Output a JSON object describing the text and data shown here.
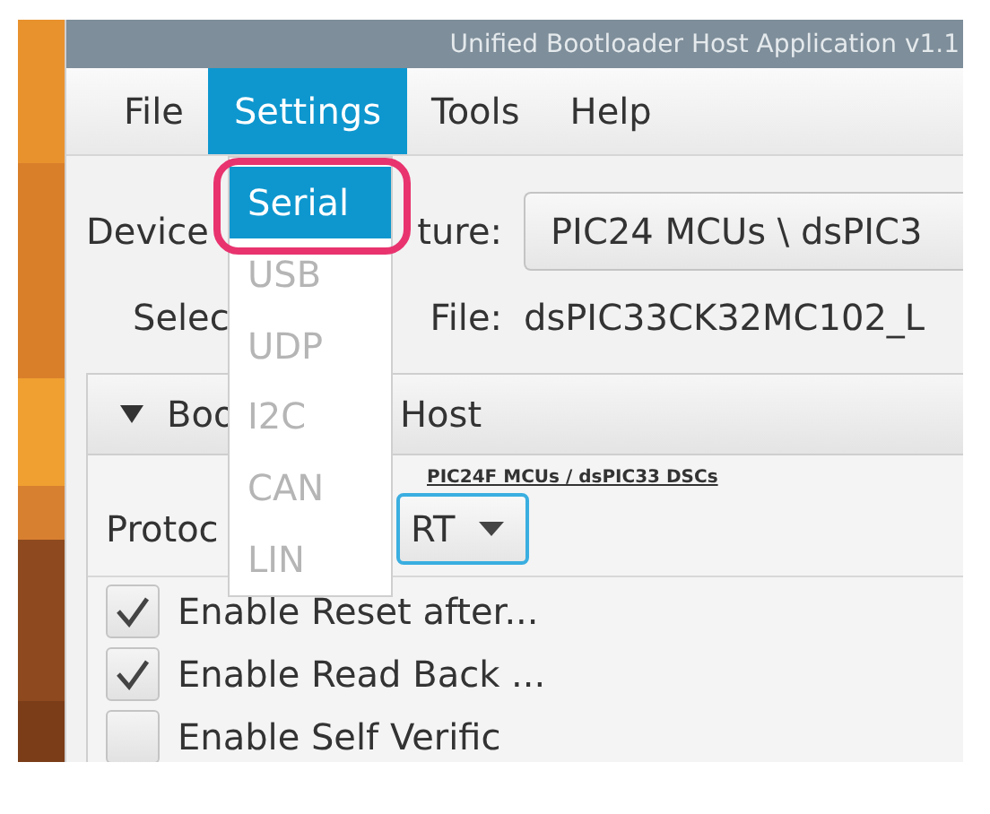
{
  "window": {
    "title": "Unified Bootloader Host Application v1.1"
  },
  "menu": [
    {
      "label": "File",
      "selected": false
    },
    {
      "label": "Settings",
      "selected": true
    },
    {
      "label": "Tools",
      "selected": false
    },
    {
      "label": "Help",
      "selected": false
    }
  ],
  "settings_menu": [
    {
      "label": "Serial",
      "selected": true,
      "disabled": false
    },
    {
      "label": "USB",
      "selected": false,
      "disabled": true
    },
    {
      "label": "UDP",
      "selected": false,
      "disabled": true
    },
    {
      "label": "I2C",
      "selected": false,
      "disabled": true
    },
    {
      "label": "CAN",
      "selected": false,
      "disabled": true
    },
    {
      "label": "LIN",
      "selected": false,
      "disabled": true
    }
  ],
  "device_row": {
    "label_parts": [
      "Device",
      "ture:"
    ],
    "value": "PIC24 MCUs \\ dsPIC3"
  },
  "file_row": {
    "label_parts": [
      "Selec",
      "File:"
    ],
    "value": "dsPIC33CK32MC102_L"
  },
  "panel": {
    "expanded": true,
    "title_parts": [
      "Boo",
      "Host"
    ],
    "family": "PIC24F MCUs / dsPIC33 DSCs",
    "protocol_label": "Protoc",
    "protocol_value": "RT",
    "options": [
      {
        "label": "Enable Reset after...",
        "checked": true
      },
      {
        "label": "Enable Read Back ...",
        "checked": true
      },
      {
        "label": "Enable Self Verific",
        "checked": false
      }
    ]
  }
}
